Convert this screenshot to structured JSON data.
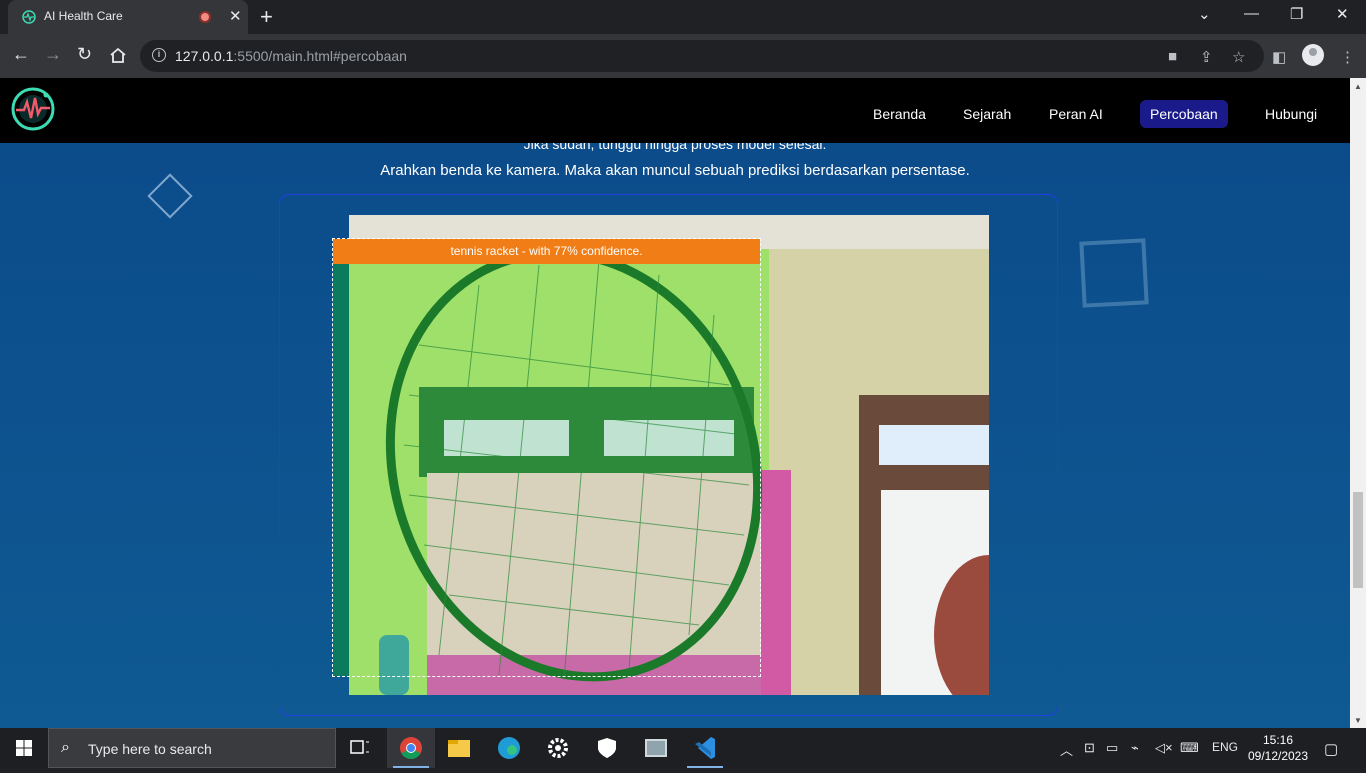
{
  "browser": {
    "tab_title": "AI Health Care",
    "url_host": "127.0.0.1",
    "url_rest": ":5500/main.html#percobaan",
    "new_tab": "+",
    "tab_close": "✕"
  },
  "navbar": {
    "items": [
      {
        "label": "Beranda"
      },
      {
        "label": "Sejarah"
      },
      {
        "label": "Peran AI"
      },
      {
        "label": "Percobaan",
        "active": true
      },
      {
        "label": "Hubungi"
      }
    ]
  },
  "content": {
    "instruction_partial": "Jika sudah, tunggu hingga proses model selesai.",
    "instruction": "Arahkan benda ke kamera. Maka akan muncul sebuah prediksi berdasarkan persentase."
  },
  "prediction": {
    "label": "tennis racket - with 77% confidence.",
    "box_color": "#f07d15"
  },
  "taskbar": {
    "search_placeholder": "Type here to search",
    "language": "ENG",
    "time": "15:16",
    "date": "09/12/2023"
  },
  "colors": {
    "page_bg": "#0b4a8a",
    "nav_active": "#1a1a8a",
    "frame_border": "#1f3fe0"
  },
  "icons": [
    "back-icon",
    "forward-icon",
    "reload-icon",
    "home-icon",
    "info-icon",
    "camera-icon",
    "share-icon",
    "star-icon",
    "sidepanel-icon",
    "profile-avatar",
    "menu-icon",
    "windows-icon",
    "search-icon",
    "task-view-icon",
    "chrome-icon",
    "explorer-icon",
    "edge-icon",
    "settings-icon",
    "security-icon",
    "photos-icon",
    "vscode-icon",
    "notification-icon"
  ]
}
